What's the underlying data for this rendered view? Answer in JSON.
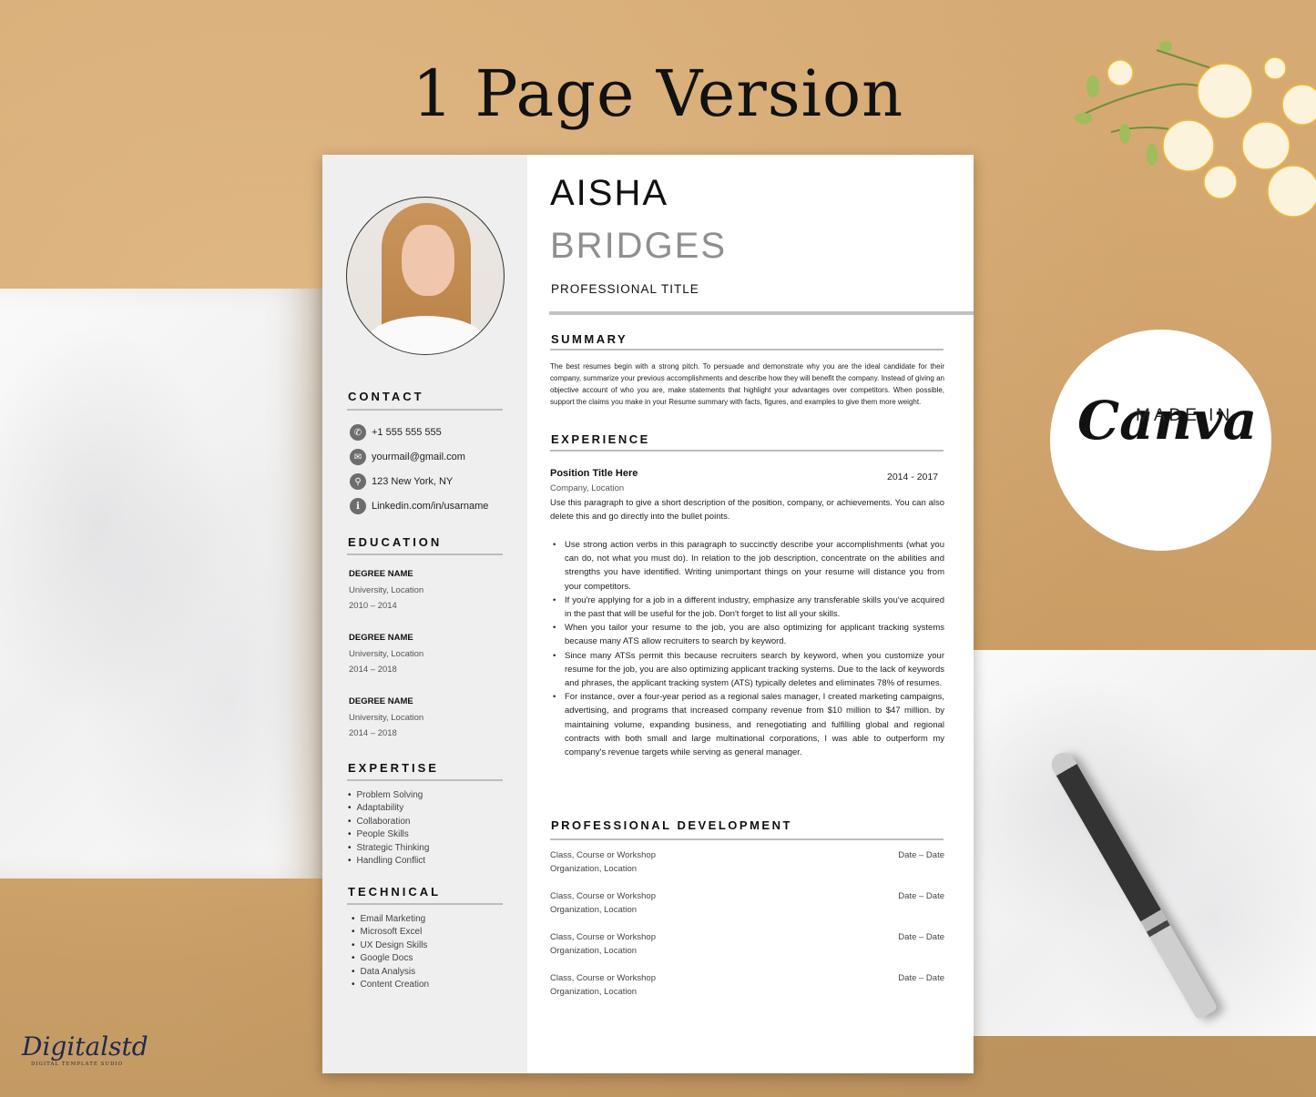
{
  "headline": "1 Page Version",
  "badge": {
    "made_in": "MADE IN",
    "brand": "Canva"
  },
  "logo": {
    "script": "Digitalstd",
    "subtitle": "DIGITAL TEMPLATE SUDIO"
  },
  "resume": {
    "first_name": "AISHA",
    "last_name": "BRIDGES",
    "professional_title": "PROFESSIONAL TITLE",
    "sidebar": {
      "contact": {
        "title": "CONTACT",
        "items": [
          {
            "icon": "phone-icon",
            "glyph": "✆",
            "text": "+1 555 555 555"
          },
          {
            "icon": "mail-icon",
            "glyph": "✉",
            "text": "yourmail@gmail.com"
          },
          {
            "icon": "location-pin-icon",
            "glyph": "⚲",
            "text": "123 New York, NY"
          },
          {
            "icon": "info-icon",
            "glyph": "i",
            "text": "Linkedin.com/in/usarname"
          }
        ]
      },
      "education": {
        "title": "EDUCATION",
        "items": [
          {
            "degree": "DEGREE NAME",
            "school": "University, Location",
            "years": "2010 – 2014"
          },
          {
            "degree": "DEGREE NAME",
            "school": "University, Location",
            "years": "2014 – 2018"
          },
          {
            "degree": "DEGREE NAME",
            "school": "University, Location",
            "years": "2014 – 2018"
          }
        ]
      },
      "expertise": {
        "title": "EXPERTISE",
        "items": [
          "Problem Solving",
          "Adaptability",
          "Collaboration",
          "People Skills",
          "Strategic Thinking",
          "Handling Conflict"
        ]
      },
      "technical": {
        "title": "TECHNICAL",
        "items": [
          "Email Marketing",
          "Microsoft Excel",
          "UX Design Skills",
          "Google Docs",
          "Data Analysis",
          "Content Creation"
        ]
      }
    },
    "summary": {
      "title": "SUMMARY",
      "text": "The best resumes begin with a strong pitch. To persuade and demonstrate why you are the ideal candidate for their company, summarize your previous accomplishments and describe how they will benefit the company. Instead of giving an objective account of who you are, make statements that highlight your advantages over competitors. When possible, support the claims you make in your Resume summary with facts, figures, and examples to give them more weight."
    },
    "experience": {
      "title": "EXPERIENCE",
      "position": "Position Title Here",
      "dates": "2014 - 2017",
      "company": "Company, Location",
      "description": "Use this paragraph to give a short description of the position, company, or achievements. You can also delete this and go directly into the bullet points.",
      "bullets": [
        "Use strong action verbs in this paragraph to succinctly describe your accomplishments (what you can do, not what you must do). In relation to the job description, concentrate on the abilities and strengths you have identified. Writing unimportant things on your resume will distance you from your competitors.",
        "If you're applying for a job in a different industry, emphasize any transferable skills you've acquired in the past that will be useful for the job. Don't forget to list all your skills.",
        "When you tailor your resume to the job, you are also optimizing for applicant tracking systems because many ATS allow recruiters to search by keyword.",
        "Since many ATSs permit this because recruiters search by keyword, when you customize your resume for the job, you are also optimizing applicant tracking systems. Due to the lack of keywords and phrases, the applicant tracking system (ATS) typically deletes and eliminates 78% of resumes.",
        "For instance, over a four-year period as a regional sales manager, I created marketing campaigns, advertising, and programs that increased company revenue from $10 million to $47 million. by maintaining volume, expanding business, and renegotiating and fulfilling global and regional contracts with both small and large multinational corporations, I was able to outperform my company's revenue targets while serving as general manager."
      ]
    },
    "professional_development": {
      "title": "PROFESSIONAL DEVELOPMENT",
      "items": [
        {
          "course": "Class, Course or Workshop",
          "org": "Organization, Location",
          "date": "Date – Date"
        },
        {
          "course": "Class, Course or Workshop",
          "org": "Organization, Location",
          "date": "Date – Date"
        },
        {
          "course": "Class, Course or Workshop",
          "org": "Organization, Location",
          "date": "Date – Date"
        },
        {
          "course": "Class, Course or Workshop",
          "org": "Organization, Location",
          "date": "Date – Date"
        }
      ]
    }
  }
}
